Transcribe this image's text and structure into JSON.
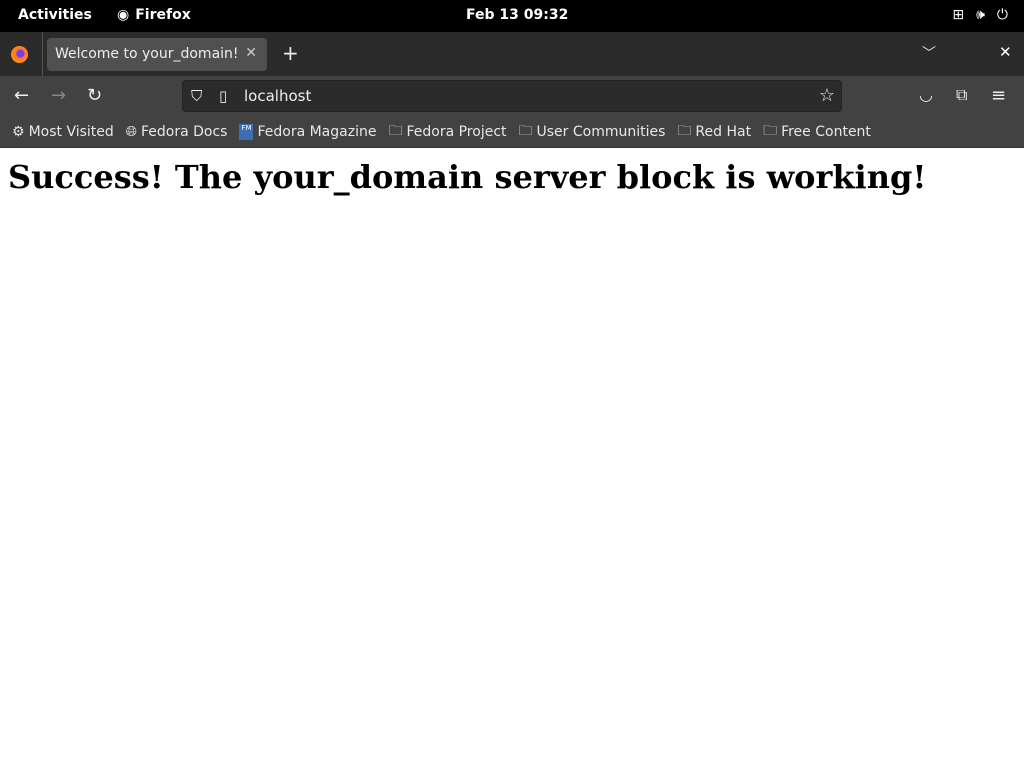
{
  "system_bar": {
    "activities": "Activities",
    "app_name": "Firefox",
    "clock": "Feb 13  09:32"
  },
  "tabs": [
    {
      "title": "Welcome to your_domain!",
      "active": true
    }
  ],
  "address_bar": {
    "url": "localhost"
  },
  "bookmarks": [
    {
      "label": "Most Visited",
      "icon": "gear-icon"
    },
    {
      "label": "Fedora Docs",
      "icon": "globe-icon"
    },
    {
      "label": "Fedora Magazine",
      "icon": "fedora-magazine-icon"
    },
    {
      "label": "Fedora Project",
      "icon": "folder-icon"
    },
    {
      "label": "User Communities",
      "icon": "folder-icon"
    },
    {
      "label": "Red Hat",
      "icon": "folder-icon"
    },
    {
      "label": "Free Content",
      "icon": "folder-icon"
    }
  ],
  "page": {
    "heading": "Success! The your_domain server block is working!"
  }
}
